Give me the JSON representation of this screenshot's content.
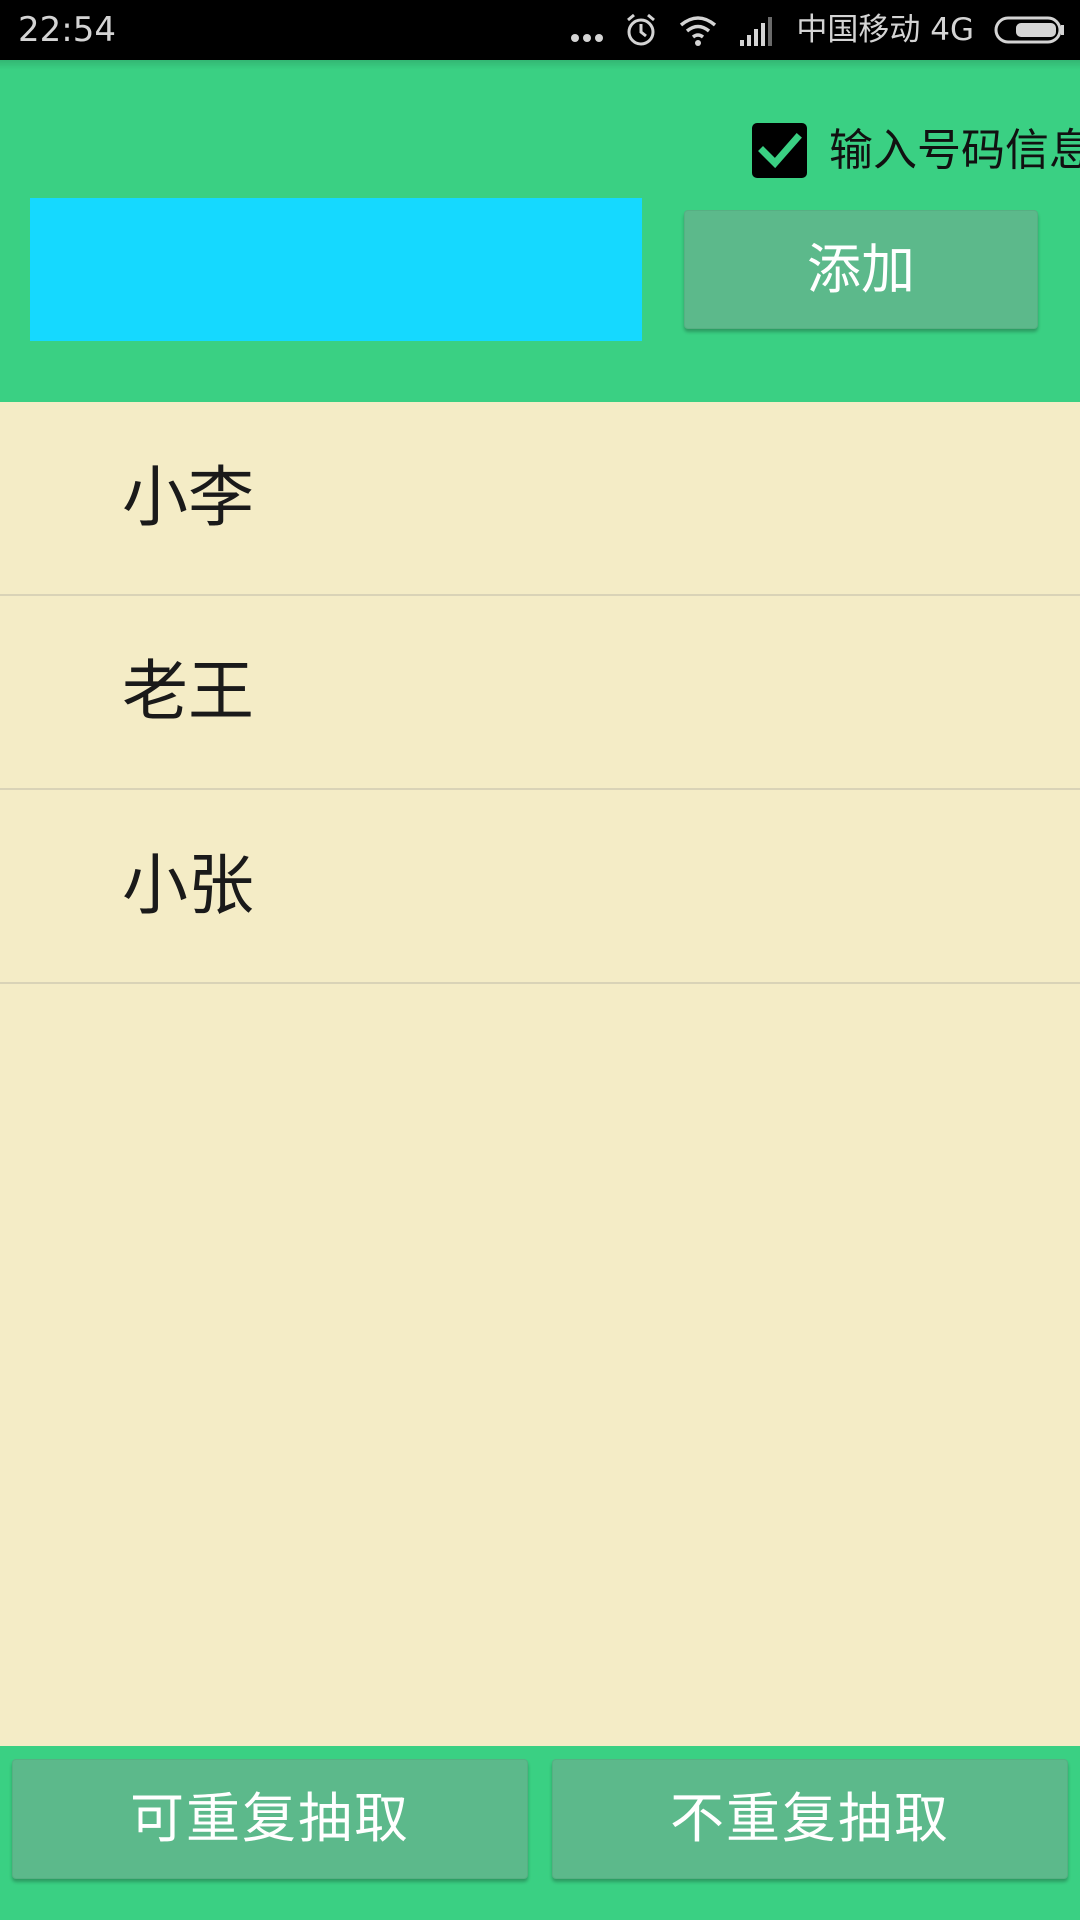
{
  "status_bar": {
    "time": "22:54",
    "carrier": "中国移动 4G",
    "icons": [
      "more-dots-icon",
      "alarm-icon",
      "wifi-icon",
      "signal-icon",
      "battery-icon"
    ]
  },
  "top_panel": {
    "checkbox": {
      "label": "输入号码信息",
      "checked": true
    },
    "input": {
      "value": "",
      "placeholder": ""
    },
    "add_button_label": "添加"
  },
  "list": {
    "items": [
      {
        "label": "小李"
      },
      {
        "label": "老王"
      },
      {
        "label": "小张"
      }
    ]
  },
  "bottom_bar": {
    "repeat_button_label": "可重复抽取",
    "no_repeat_button_label": "不重复抽取"
  },
  "colors": {
    "panel_green": "#3ad083",
    "button_green": "#5cb98b",
    "input_cyan": "#15d9ff",
    "list_background": "#f4ecc6"
  }
}
